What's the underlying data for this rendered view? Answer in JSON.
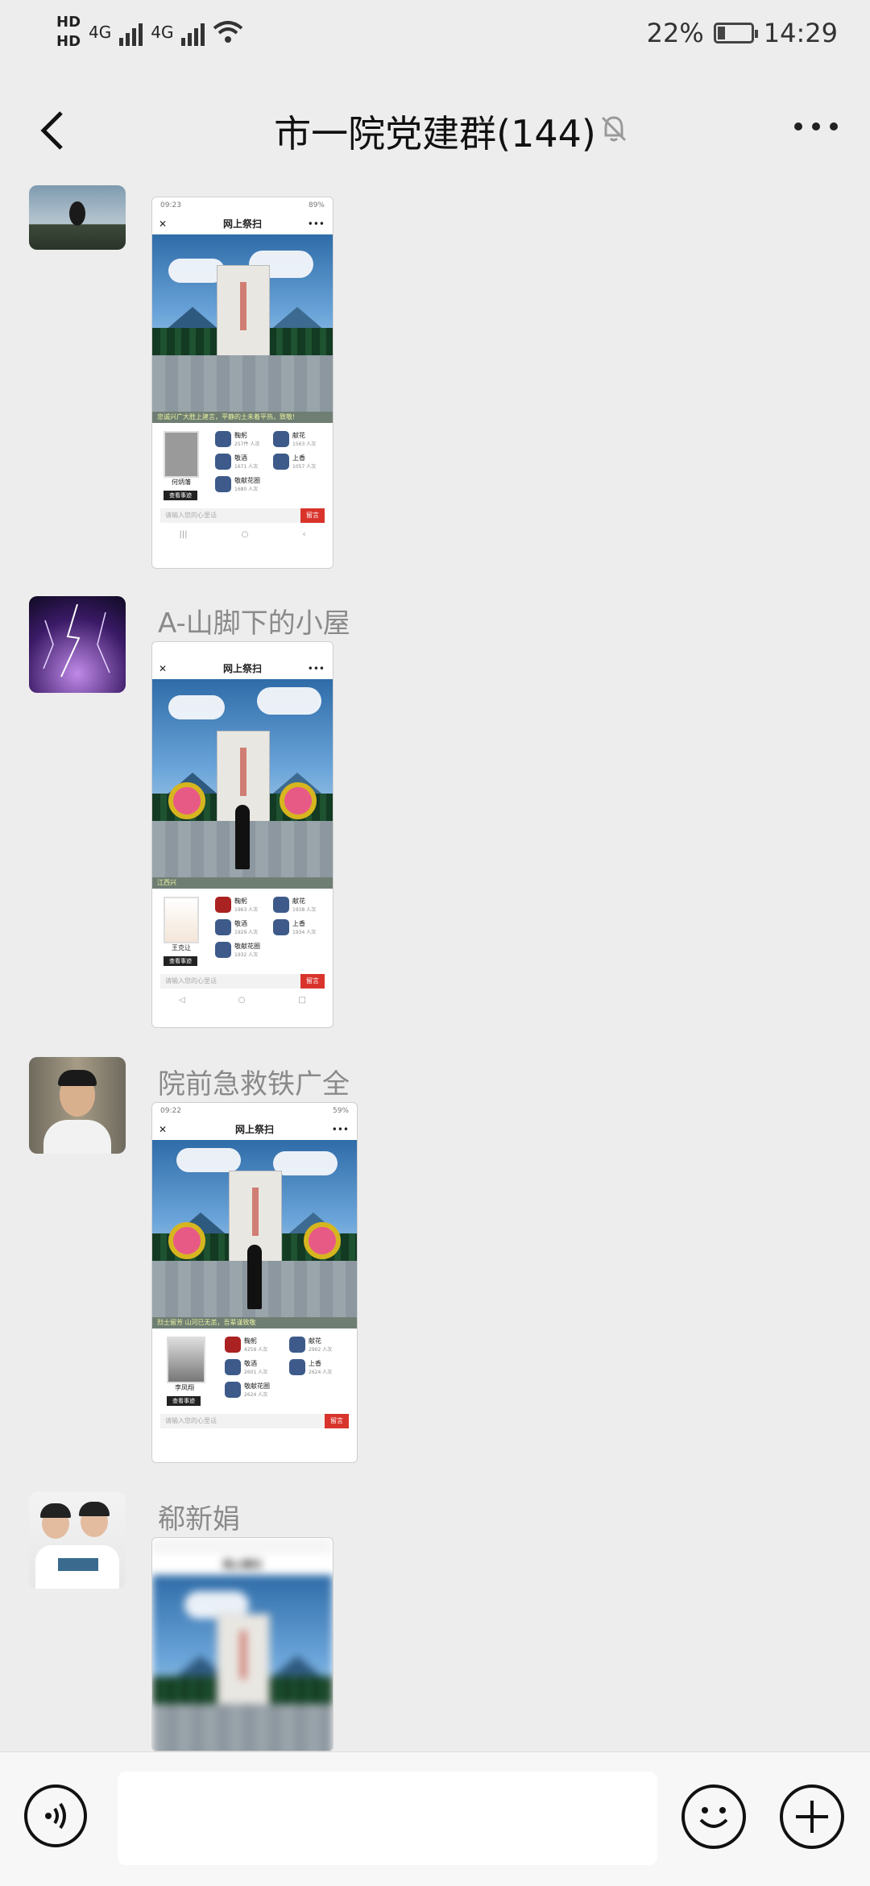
{
  "status_bar": {
    "hd1": "HD",
    "hd2": "HD",
    "net1": "4G",
    "net2": "4G",
    "battery_pct": "22%",
    "time": "14:29",
    "battery_level": 0.22
  },
  "header": {
    "title": "市一院党建群(144)"
  },
  "messages": [
    {
      "sender": "",
      "shot": {
        "time": "09:23",
        "battery": "89%",
        "title": "网上祭扫",
        "ticker": "忠诚兴广大胜上建言，平静的土未着平热，致敬!",
        "portrait_name": "何炳藩",
        "record_label": "查看事迹",
        "actions": [
          {
            "label": "鞠躬",
            "count": "257件 人次"
          },
          {
            "label": "献花",
            "count": "1563 人次"
          },
          {
            "label": "敬酒",
            "count": "1671 人次"
          },
          {
            "label": "上香",
            "count": "1057 人次"
          },
          {
            "label": "敬献花圈",
            "count": "1680 人次"
          }
        ],
        "input_placeholder": "请输入您的心里话",
        "send": "留言"
      }
    },
    {
      "sender": "A-山脚下的小屋",
      "shot": {
        "time": "",
        "battery": "",
        "title": "网上祭扫",
        "ticker": "江西兴",
        "portrait_name": "王克让",
        "record_label": "查看事迹",
        "actions": [
          {
            "label": "鞠躬",
            "count": "1963 人次"
          },
          {
            "label": "献花",
            "count": "1938 人次"
          },
          {
            "label": "敬酒",
            "count": "1929 人次"
          },
          {
            "label": "上香",
            "count": "1934 人次"
          },
          {
            "label": "敬献花圈",
            "count": "1932 人次"
          }
        ],
        "input_placeholder": "请输入您的心里话",
        "send": "留言"
      }
    },
    {
      "sender": "院前急救铁广全",
      "shot": {
        "time": "09:22",
        "battery": "59%",
        "title": "网上祭扫",
        "ticker": "烈士留芳  山河已无恙，吾辈谨致敬",
        "portrait_name": "李凤翔",
        "record_label": "查看事迹",
        "actions": [
          {
            "label": "鞠躬",
            "count": "4259 人次"
          },
          {
            "label": "献花",
            "count": "2902 人次"
          },
          {
            "label": "敬酒",
            "count": "2601 人次"
          },
          {
            "label": "上香",
            "count": "2624 人次"
          },
          {
            "label": "敬献花圈",
            "count": "2624 人次"
          }
        ],
        "input_placeholder": "请输入您的心里话",
        "send": "留言"
      }
    },
    {
      "sender": "郗新娟",
      "shot": {
        "title": "网上祭扫"
      }
    }
  ],
  "colors": {
    "background": "#ededed",
    "send_red": "#d9342c"
  }
}
